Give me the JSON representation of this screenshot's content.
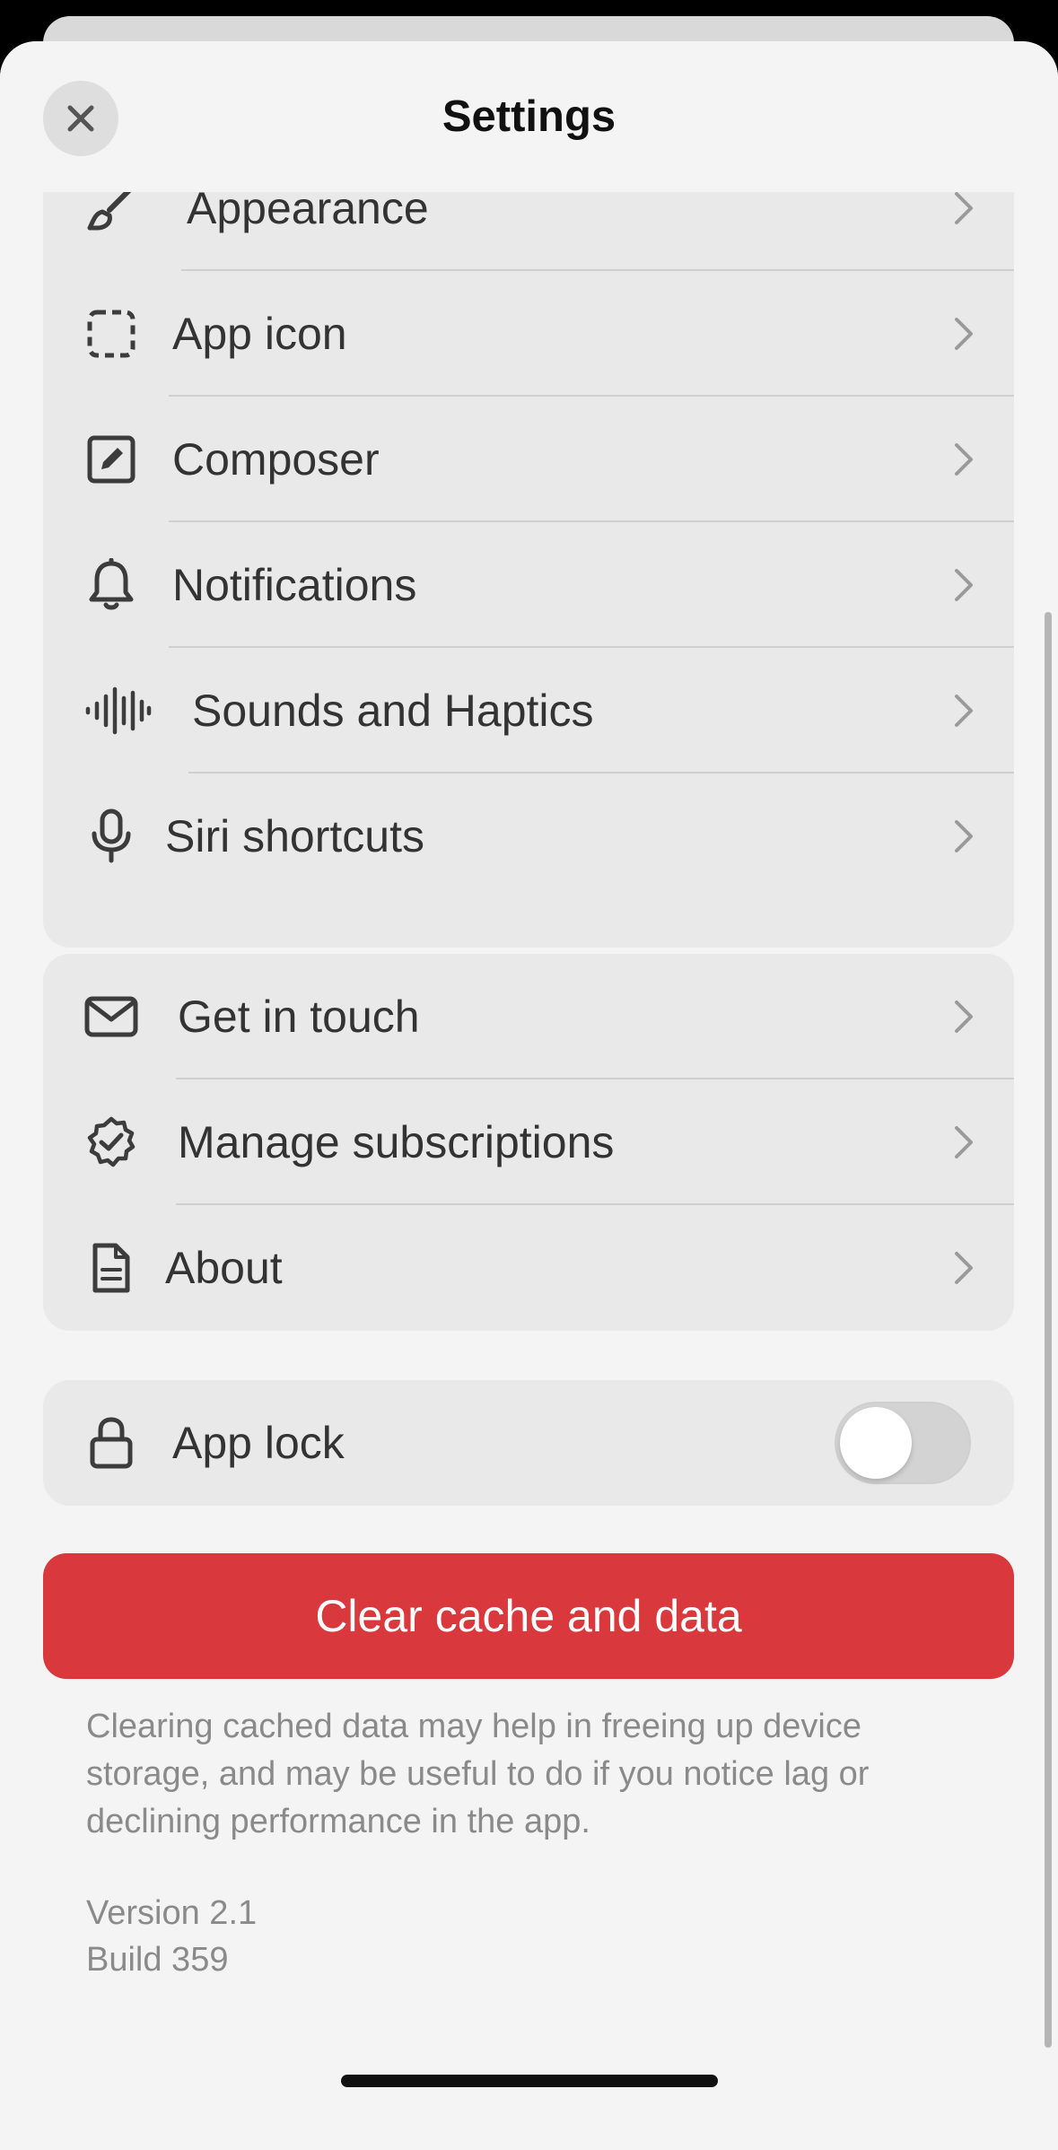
{
  "header": {
    "title": "Settings",
    "close_icon": "close-icon"
  },
  "group1": {
    "items": [
      {
        "label": "Appearance",
        "icon": "paintbrush-icon"
      },
      {
        "label": "App icon",
        "icon": "dashed-square-icon"
      },
      {
        "label": "Composer",
        "icon": "compose-icon"
      },
      {
        "label": "Notifications",
        "icon": "bell-icon"
      },
      {
        "label": "Sounds and Haptics",
        "icon": "waveform-icon"
      },
      {
        "label": "Siri shortcuts",
        "icon": "microphone-icon"
      }
    ]
  },
  "group2": {
    "items": [
      {
        "label": "Get in touch",
        "icon": "envelope-icon"
      },
      {
        "label": "Manage subscriptions",
        "icon": "checkmark-seal-icon"
      },
      {
        "label": "About",
        "icon": "document-icon"
      }
    ]
  },
  "group3": {
    "app_lock": {
      "label": "App lock",
      "icon": "lock-icon",
      "enabled": false
    }
  },
  "clear_button": {
    "label": "Clear cache and data"
  },
  "note": "Clearing cached data may help in freeing up device storage, and may be useful to do if you notice lag or declining performance in the app.",
  "version": {
    "version": "Version 2.1",
    "build": "Build 359"
  },
  "colors": {
    "danger": "#d9383c",
    "group_bg": "#e9e9e9",
    "sheet_bg": "#f4f4f4"
  }
}
